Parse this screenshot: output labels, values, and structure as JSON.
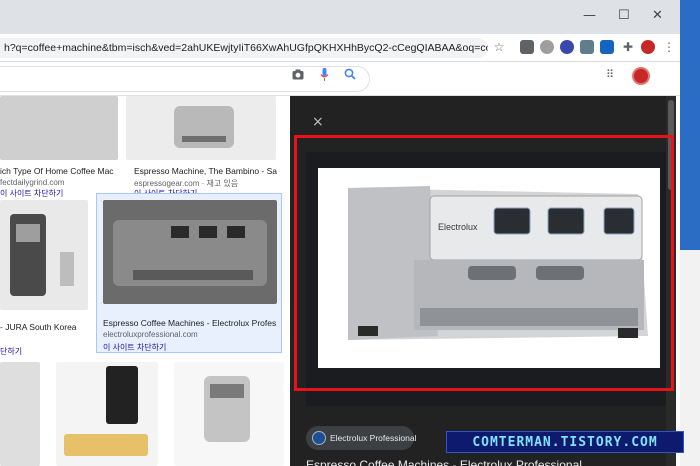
{
  "browser": {
    "url": "h?q=coffee+machine&tbm=isch&ved=2ahUKEwjtyIiT66XwAhUGfpQKHXHhBycQ2-cCegQIABAA&oq=coffee+machi...",
    "window_controls": {
      "minimize": "—",
      "maximize": "☐",
      "close": "✕"
    }
  },
  "grid": {
    "items": [
      {
        "caption": "ich Type Of Home Coffee Mac",
        "source": "fectdailygrind.com",
        "related": "이 사이트 차단하기"
      },
      {
        "caption": "Espresso Machine, The Bambino - Sa",
        "source": "espressogear.com · 재고 있음",
        "related": "이 사이트 차단하기"
      },
      {
        "caption": "- JURA South Korea",
        "source": "",
        "related": "단하기"
      },
      {
        "caption": "Espresso Coffee Machines - Electrolux Profes",
        "source": "electroluxprofessional.com",
        "related": "이 사이트 차단하기"
      }
    ]
  },
  "preview": {
    "close": "×",
    "brand": "Electrolux Professional",
    "title": "Espresso Coffee Machines - Electrolux Professional",
    "machine_brand": "Electrolux"
  },
  "watermark": "COMTERMAN.TISTORY.COM",
  "colors": {
    "highlight": "#e8121b",
    "panel": "#222222",
    "watermark_bg": "#0d1a6e",
    "watermark_fg": "#7fe3ff"
  }
}
